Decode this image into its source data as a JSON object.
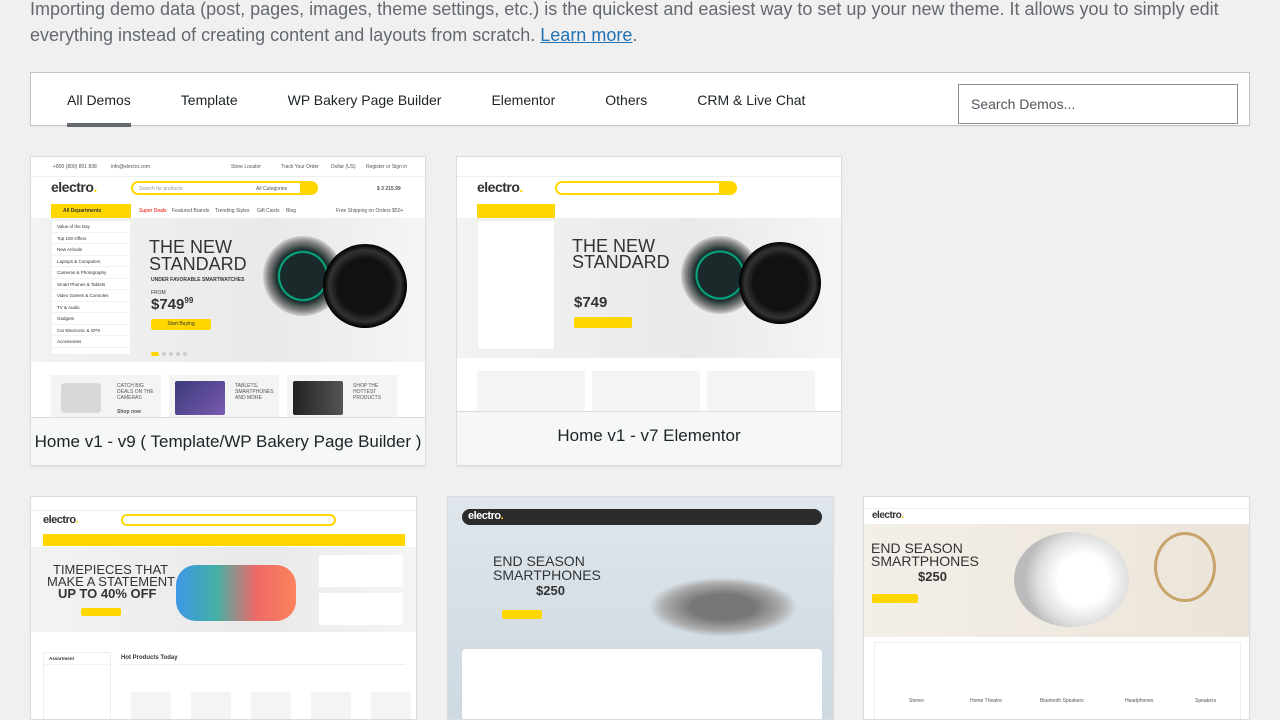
{
  "intro": {
    "text": "Importing demo data (post, pages, images, theme settings, etc.) is the quickest and easiest way to set up your new theme. It allows you to simply edit everything instead of creating content and layouts from scratch. ",
    "link": "Learn more",
    "end": "."
  },
  "tabs": [
    {
      "label": "All Demos",
      "active": true
    },
    {
      "label": "Template"
    },
    {
      "label": "WP Bakery Page Builder"
    },
    {
      "label": "Elementor"
    },
    {
      "label": "Others"
    },
    {
      "label": "CRM & Live Chat"
    }
  ],
  "search": {
    "placeholder": "Search Demos..."
  },
  "colors": {
    "accent": "#fed700",
    "link": "#2271b1"
  },
  "demos": [
    {
      "caption": "Home v1 - v9 ( Template/WP Bakery Page Builder )",
      "logo": "electro",
      "phone": "+800 (800) 801 838",
      "email": "info@electro.com",
      "store_locator": "Store Locator",
      "track": "Track Your Order",
      "currency": "Dollar (US)",
      "register": "Register or Sign in",
      "search_ph": "Search for products",
      "categories": "All Categories",
      "cart": "$ 3 215.99",
      "all_departments": "All Departments",
      "nav": [
        "Super Deals",
        "Featured Brands",
        "Trending Styles",
        "Gift Cards",
        "Blog"
      ],
      "shipping": "Free Shipping on Orders $50+",
      "menu": [
        "Value of the Day",
        "Top 100 Offers",
        "New Arrivals",
        "Laptops & Computers",
        "Cameras & Photography",
        "Smart Phones & Tablets",
        "Video Games & Consoles",
        "TV & Audio",
        "Gadgets",
        "Car Electronic & GPS",
        "Accessories"
      ],
      "hero1": "THE NEW",
      "hero2": "STANDARD",
      "hero_sub": "UNDER FAVORABLE SMARTWATCHES",
      "from": "FROM",
      "price": "$749",
      "price_cents": "99",
      "cta": "Start Buying",
      "promos": [
        "CATCH BIG DEALS ON THE CAMERAS",
        "TABLETS, SMARTPHONES AND MORE",
        "SHOP THE HOTTEST PRODUCTS"
      ],
      "shop_now": "Shop now"
    },
    {
      "caption": "Home v1 - v7 Elementor",
      "logo": "electro"
    },
    {
      "caption": "",
      "logo": "electro",
      "hero1": "TIMEPIECES THAT",
      "hero2": "MAKE A STATEMENT",
      "hero3": "UP TO 40% OFF",
      "section": "Hot Products Today",
      "side": "Assortment"
    },
    {
      "caption": "",
      "logo": "electro",
      "hero1": "END SEASON",
      "hero2": "SMARTPHONES",
      "price": "$250"
    },
    {
      "caption": "",
      "logo": "electro",
      "hero1": "END SEASON",
      "hero2": "SMARTPHONES",
      "price": "$250",
      "cats": [
        "Stereo",
        "Home Theatre",
        "Bluetooth Speakers",
        "Headphones",
        "Speakers"
      ]
    }
  ]
}
